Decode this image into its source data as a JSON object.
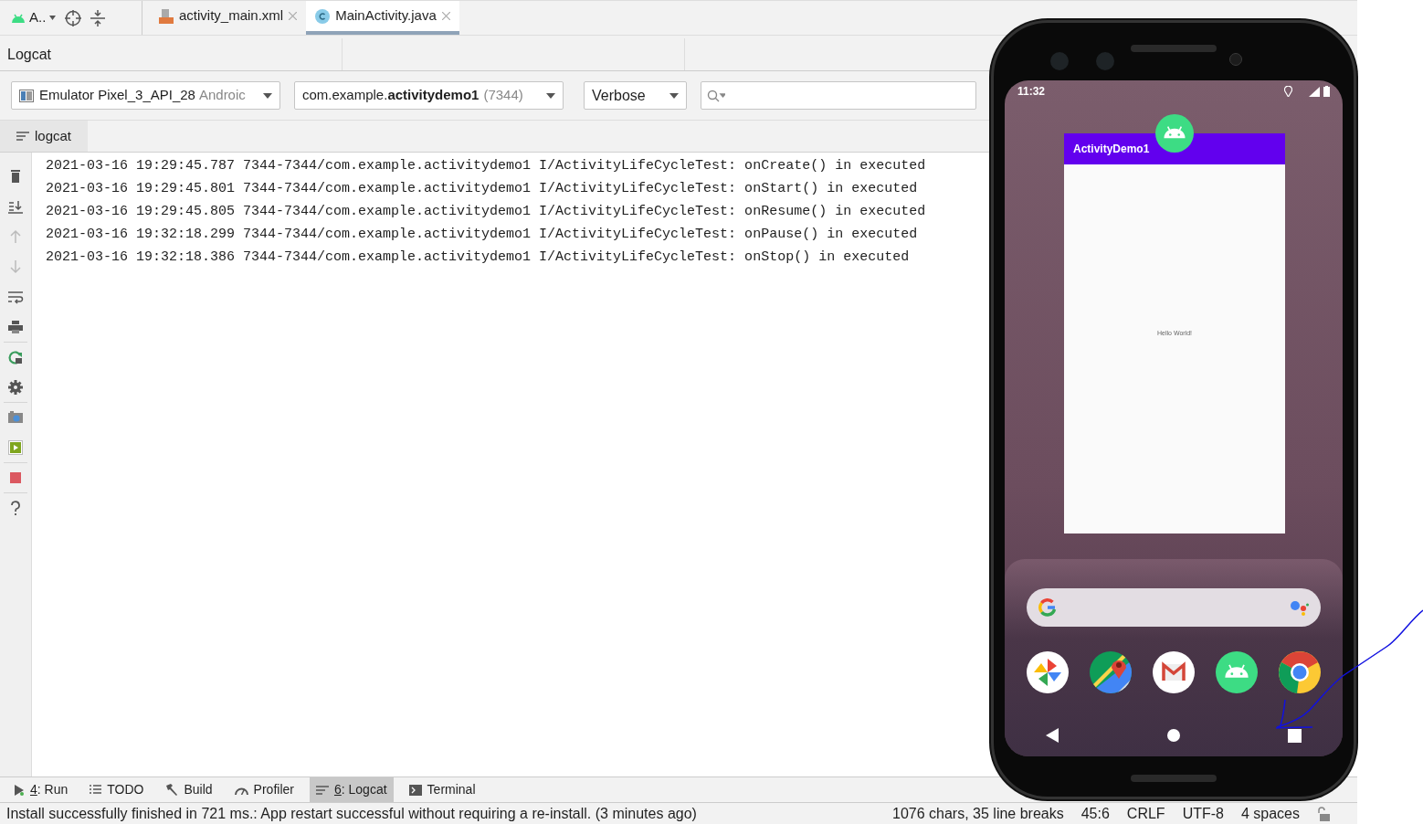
{
  "toolbar": {
    "config_label": "A.."
  },
  "editor_tabs": [
    {
      "label": "activity_main.xml",
      "kind": "xml",
      "selected": false
    },
    {
      "label": "MainActivity.java",
      "kind": "java",
      "selected": true
    }
  ],
  "logcat": {
    "title": "Logcat",
    "device_dropdown": {
      "value": "Emulator Pixel_3_API_28",
      "suffix": "Androic"
    },
    "process_dropdown": {
      "value": "com.example.**activitydemo1**",
      "suffix": "(7344)"
    },
    "level_dropdown": {
      "value": "Verbose"
    },
    "tab": "logcat",
    "lines": [
      "2021-03-16 19:29:45.787 7344-7344/com.example.activitydemo1 I/ActivityLifeCycleTest: onCreate() in executed",
      "2021-03-16 19:29:45.801 7344-7344/com.example.activitydemo1 I/ActivityLifeCycleTest: onStart() in executed",
      "2021-03-16 19:29:45.805 7344-7344/com.example.activitydemo1 I/ActivityLifeCycleTest: onResume() in executed",
      "2021-03-16 19:32:18.299 7344-7344/com.example.activitydemo1 I/ActivityLifeCycleTest: onPause() in executed",
      "2021-03-16 19:32:18.386 7344-7344/com.example.activitydemo1 I/ActivityLifeCycleTest: onStop() in executed"
    ]
  },
  "tool_tabs": [
    {
      "kind": "run",
      "key": "4",
      "label": ": Run",
      "selected": false
    },
    {
      "kind": "todo",
      "label": "TODO",
      "selected": false
    },
    {
      "kind": "build",
      "label": "Build",
      "selected": false
    },
    {
      "kind": "profiler",
      "label": "Profiler",
      "selected": false
    },
    {
      "kind": "logcat",
      "key": "6",
      "label": ": Logcat",
      "selected": true
    },
    {
      "kind": "terminal",
      "label": "Terminal",
      "selected": false
    }
  ],
  "status_bar": {
    "message": "Install successfully finished in 721 ms.: App restart successful without requiring a re-install. (3 minutes ago)",
    "items": [
      "1076 chars, 35 line breaks",
      "45:6",
      "CRLF",
      "UTF-8",
      "4 spaces"
    ]
  },
  "emulator": {
    "time": "11:32",
    "app_title": "ActivityDemo1",
    "app_text": "Hello World!"
  }
}
